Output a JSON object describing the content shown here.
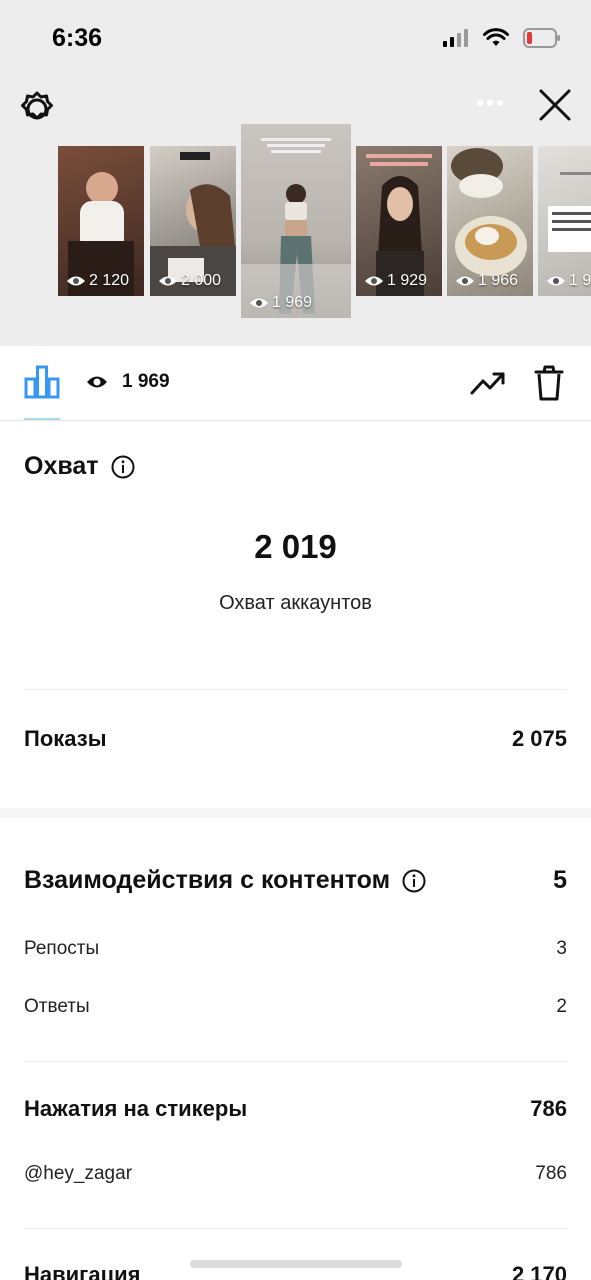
{
  "status_bar": {
    "time": "6:36"
  },
  "stories": [
    {
      "views": "2 120",
      "bg": "#5a3a2e"
    },
    {
      "views": "2 000",
      "bg": "#8d8680"
    },
    {
      "views": "1 969",
      "bg": "#9a9692"
    },
    {
      "views": "1 929",
      "bg": "#6b5a50"
    },
    {
      "views": "1 966",
      "bg": "#a89f90"
    },
    {
      "views": "1 9",
      "bg": "#c9c7c3"
    }
  ],
  "tabs": {
    "views_count": "1 969"
  },
  "reach": {
    "title": "Охват",
    "value": "2 019",
    "caption": "Охват аккаунтов"
  },
  "impressions": {
    "label": "Показы",
    "value": "2 075"
  },
  "interactions": {
    "title": "Взаимодействия с контентом",
    "value": "5",
    "items": [
      {
        "label": "Репосты",
        "value": "3"
      },
      {
        "label": "Ответы",
        "value": "2"
      }
    ]
  },
  "sticker_taps": {
    "label": "Нажатия на стикеры",
    "value": "786",
    "items": [
      {
        "label": "@hey_zagar",
        "value": "786"
      }
    ]
  },
  "navigation": {
    "label": "Навигация",
    "value": "2 170"
  },
  "colors": {
    "accent": "#3897f0",
    "header_bg": "#ededed"
  }
}
